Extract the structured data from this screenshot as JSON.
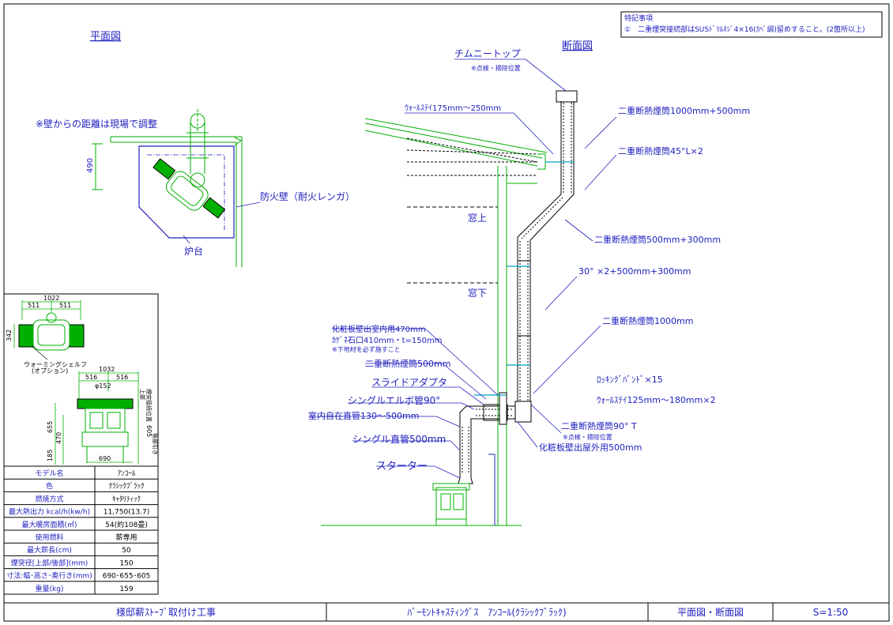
{
  "colors": {
    "cad_green": "#00b000",
    "cad_blue": "#2020c0",
    "cad_cyan": "#00a0c0",
    "ink": "#000000"
  },
  "notes_box": {
    "heading": "特記事項",
    "item": "①　二重煙突接続部はSUSﾄﾞﾘﾙﾈｼﾞ4×16(ｶﾍﾞ調)留めすること。(2箇所以上)"
  },
  "plan": {
    "title": "平面図",
    "wall_distance_note": "※壁からの距離は現場で調整",
    "dim_490": "490",
    "firewall_label": "防火壁（耐火レンガ）",
    "hearth_label": "炉台"
  },
  "section": {
    "title": "断面図",
    "labels": {
      "chimney_top": "チムニートップ",
      "chimney_top_note": "※点検・掃除位置",
      "wall_stay_top": "ｳｫｰﾙｽﾃｲ175mm～250mm",
      "pipe_1000_500": "二重断熱煙筒1000mm+500mm",
      "elbow_45": "二重断熱煙筒45°L×2",
      "window_upper": "窓上",
      "pipe_500_300": "二重断熱煙筒500mm+300mm",
      "angle_30": "30° ×2+500mm+300mm",
      "window_lower": "窓下",
      "pipe_1000": "二重断熱煙筒1000mm",
      "wall_inside_470": "化粧板壁出室内用470mm",
      "stone_410": "ｶｹﾞﾈ石口410mm・t=150mm",
      "sub_note": "※下地材を必ず施すこと",
      "pipe_500": "二重断熱煙筒500mm",
      "slide_adapter": "スライドアダプタ",
      "single_elbow": "シングルエルボ管90°",
      "indoor_pipe": "室内自在直管130～500mm",
      "single_straight": "シングル直管500mm",
      "starter": "スターター",
      "locking_band": "ﾛｯｷﾝｸﾞﾊﾞﾝﾄﾞ×15",
      "wall_stay_bottom": "ｳｫｰﾙｽﾃｲ125mm～180mm×2",
      "tee_90": "二重断熱煙筒90° T",
      "tee_note": "※点検・掃除位置",
      "wall_outside_500": "化粧板壁出屋外用500mm"
    }
  },
  "stove_views": {
    "top": {
      "total": "1022",
      "left": "511",
      "right": "511",
      "depth": "342",
      "shelf_label": "ウォーミングシェルフ",
      "shelf_option": "(オプション)"
    },
    "front": {
      "total": "1032",
      "left": "516",
      "right": "516",
      "flue": "φ152",
      "h655": "655",
      "h470": "470",
      "h185": "185",
      "width": "690",
      "side_h605": "605",
      "side_label_1": "上部",
      "side_label_2": "煙突接続位置",
      "side_label_3": "後部引き"
    }
  },
  "spec_table": {
    "rows": [
      {
        "label": "モデル名",
        "value": "ｱﾝｺｰﾙ"
      },
      {
        "label": "色",
        "value": "ｸﾗｼｯｸﾌﾞﾗｯｸ"
      },
      {
        "label": "燃焼方式",
        "value": "ｷｬﾀﾘﾃｨｯｸ"
      },
      {
        "label": "最大熱出力 kcal/h(kw/h)",
        "value": "11,750(13.7)"
      },
      {
        "label": "最大暖房面積(㎡)",
        "value": "54(約108畳)"
      },
      {
        "label": "使用燃料",
        "value": "薪専用"
      },
      {
        "label": "最大薪長(cm)",
        "value": "50"
      },
      {
        "label": "煙突径[上部/後部](mm)",
        "value": "150"
      },
      {
        "label": "寸法:幅･高さ･奥行き(mm)",
        "value": "690･655･605"
      },
      {
        "label": "重量(kg)",
        "value": "159"
      }
    ]
  },
  "title_block": {
    "project": "様邸薪ｽﾄｰﾌﾞ取付け工事",
    "product": "ﾊﾞｰﾓﾝﾄｷｬｽﾃｨﾝｸﾞｽ　ｱﾝｺｰﾙ(ｸﾗｼｯｸﾌﾞﾗｯｸ)",
    "drawing": "平面図・断面図",
    "scale": "S=1:50"
  }
}
